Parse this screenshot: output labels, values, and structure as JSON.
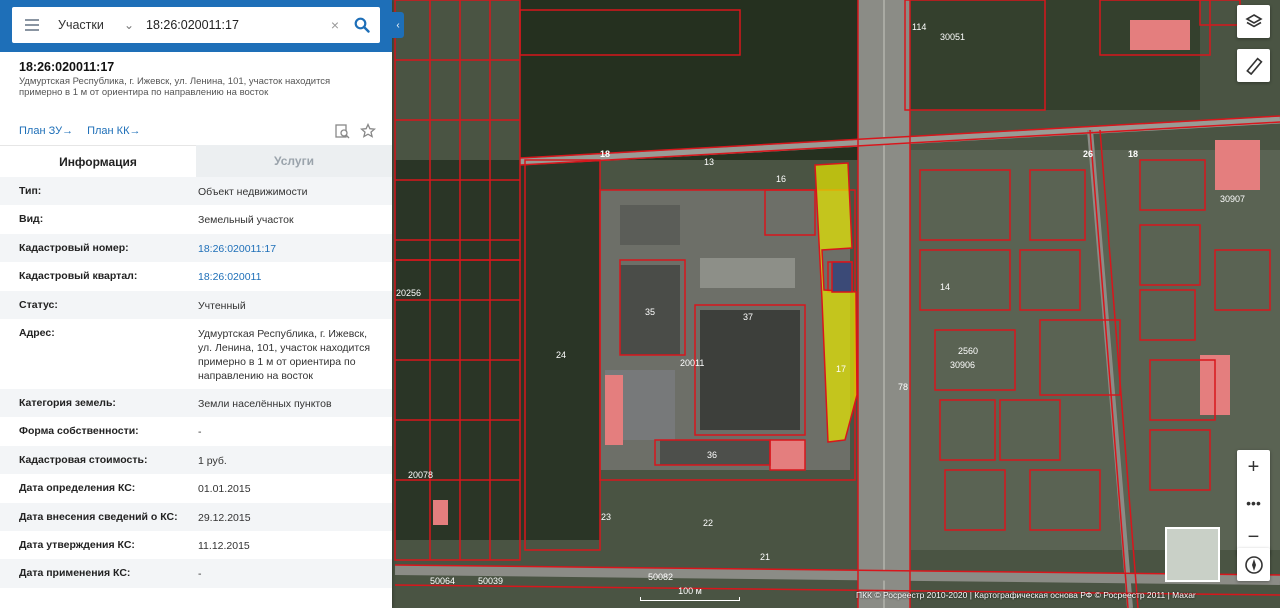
{
  "search": {
    "type_label": "Участки",
    "query": "18:26:020011:17"
  },
  "parcel": {
    "number": "18:26:020011:17",
    "address": "Удмуртская Республика, г. Ижевск, ул. Ленина, 101, участок находится примерно в 1 м от ориентира по направлению на восток"
  },
  "links": {
    "plan_zu": "План ЗУ",
    "plan_kk": "План КК"
  },
  "tabs": {
    "info": "Информация",
    "services": "Услуги"
  },
  "info_rows": [
    {
      "label": "Тип:",
      "value": "Объект недвижимости"
    },
    {
      "label": "Вид:",
      "value": "Земельный участок"
    },
    {
      "label": "Кадастровый номер:",
      "value": "18:26:020011:17"
    },
    {
      "label": "Кадастровый квартал:",
      "value": "18:26:020011"
    },
    {
      "label": "Статус:",
      "value": "Учтенный"
    },
    {
      "label": "Адрес:",
      "value": "Удмуртская Республика, г. Ижевск, ул. Ленина, 101, участок находится примерно в 1 м от ориентира по направлению на восток"
    },
    {
      "label": "Категория земель:",
      "value": "Земли населённых пунктов"
    },
    {
      "label": "Форма собственности:",
      "value": "-"
    },
    {
      "label": "Кадастровая стоимость:",
      "value": "1 руб."
    },
    {
      "label": "Дата определения КС:",
      "value": "01.01.2015"
    },
    {
      "label": "Дата внесения сведений о КС:",
      "value": "29.12.2015"
    },
    {
      "label": "Дата утверждения КС:",
      "value": "11.12.2015"
    },
    {
      "label": "Дата применения КС:",
      "value": "-"
    }
  ],
  "map": {
    "labels": {
      "road_18_a": "18",
      "road_18_b": "18",
      "road_26": "26",
      "block_20011": "20011",
      "block_30051": "30051",
      "block_30906": "30906",
      "block_30907": "30907",
      "block_50082": "50082",
      "block_50064": "50064",
      "block_50039": "50039",
      "block_20078": "20078",
      "block_20256": "20256",
      "parcel_17": "17",
      "parcel_13": "13",
      "parcel_35": "35",
      "parcel_37": "37",
      "parcel_36": "36",
      "parcel_24": "24",
      "parcel_23": "23",
      "parcel_22": "22",
      "parcel_21": "21",
      "parcel_78": "78",
      "parcel_114": "114",
      "parcel_2560": "2560",
      "parcel_14": "14",
      "parcel_16": "16"
    },
    "scale": "100 м",
    "attribution": "ПКК © Росреестр 2010-2020 | Картографическая основа РФ © Росреестр 2011 | Maxar"
  },
  "colors": {
    "brand": "#1e6fb8",
    "parcel_border": "#d8161c",
    "selected_fill": "#e6e600"
  }
}
